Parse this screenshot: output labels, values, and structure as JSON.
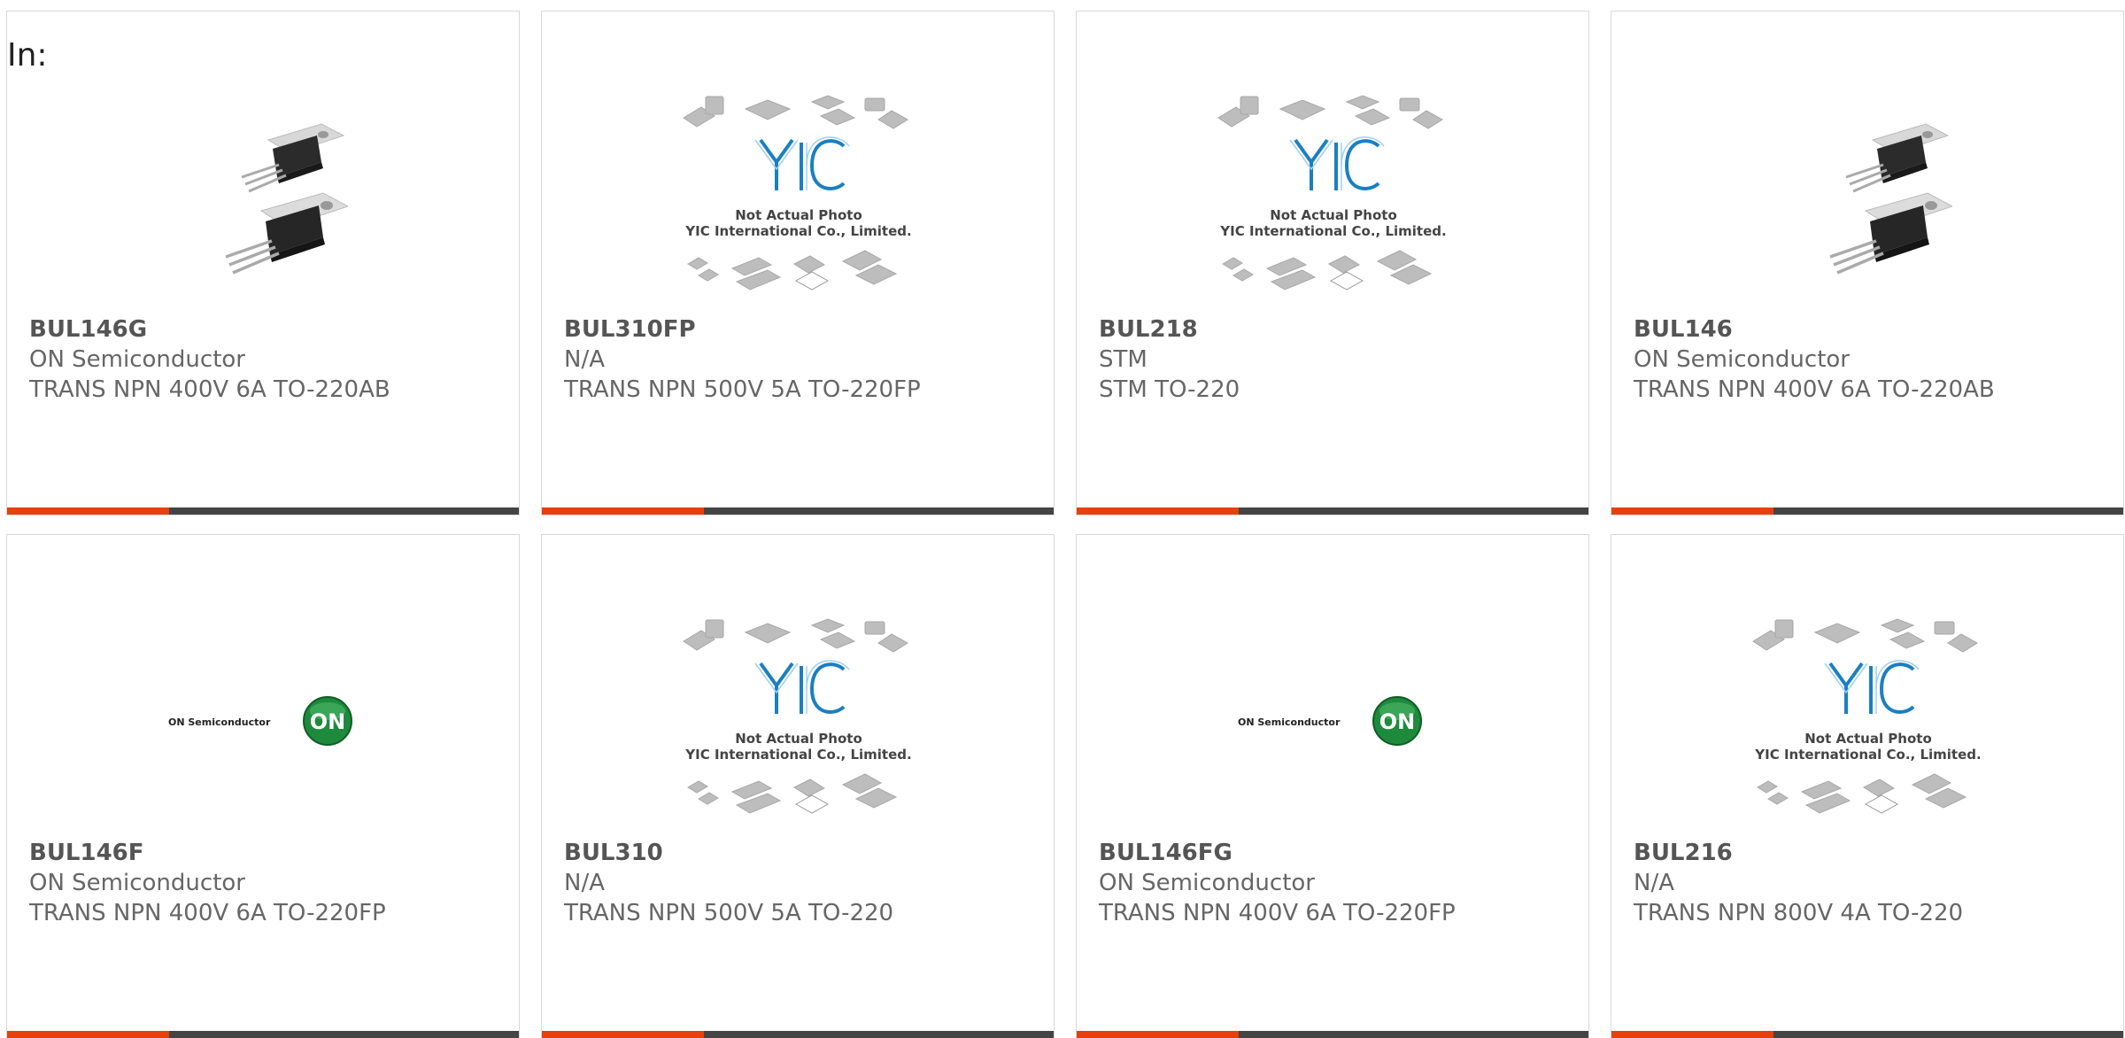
{
  "header": {
    "label": "In:"
  },
  "placeholder_image": {
    "line1": "Not Actual Photo",
    "line2": "YIC International Co., Limited.",
    "logo_text": "YIC"
  },
  "on_logo": {
    "wordmark": "ON Semiconductor",
    "badge": "ON"
  },
  "colors": {
    "accent": "#e8400c",
    "bar_dark": "#444444",
    "on_green": "#1e8a3c",
    "yic_blue": "#1b7fc2"
  },
  "products": [
    {
      "part_number": "BUL146G",
      "manufacturer": "ON Semiconductor",
      "description": "TRANS NPN 400V 6A TO-220AB",
      "image": "transistor-photo-icon"
    },
    {
      "part_number": "BUL310FP",
      "manufacturer": "N/A",
      "description": "TRANS NPN 500V 5A TO-220FP",
      "image": "yic-placeholder-icon"
    },
    {
      "part_number": "BUL218",
      "manufacturer": "STM",
      "description": "STM TO-220",
      "image": "yic-placeholder-icon"
    },
    {
      "part_number": "BUL146",
      "manufacturer": "ON Semiconductor",
      "description": "TRANS NPN 400V 6A TO-220AB",
      "image": "transistor-photo-icon"
    },
    {
      "part_number": "BUL146F",
      "manufacturer": "ON Semiconductor",
      "description": "TRANS NPN 400V 6A TO-220FP",
      "image": "on-semiconductor-logo-icon"
    },
    {
      "part_number": "BUL310",
      "manufacturer": "N/A",
      "description": "TRANS NPN 500V 5A TO-220",
      "image": "yic-placeholder-icon"
    },
    {
      "part_number": "BUL146FG",
      "manufacturer": "ON Semiconductor",
      "description": "TRANS NPN 400V 6A TO-220FP",
      "image": "on-semiconductor-logo-icon"
    },
    {
      "part_number": "BUL216",
      "manufacturer": "N/A",
      "description": "TRANS NPN 800V 4A TO-220",
      "image": "yic-placeholder-icon"
    }
  ]
}
